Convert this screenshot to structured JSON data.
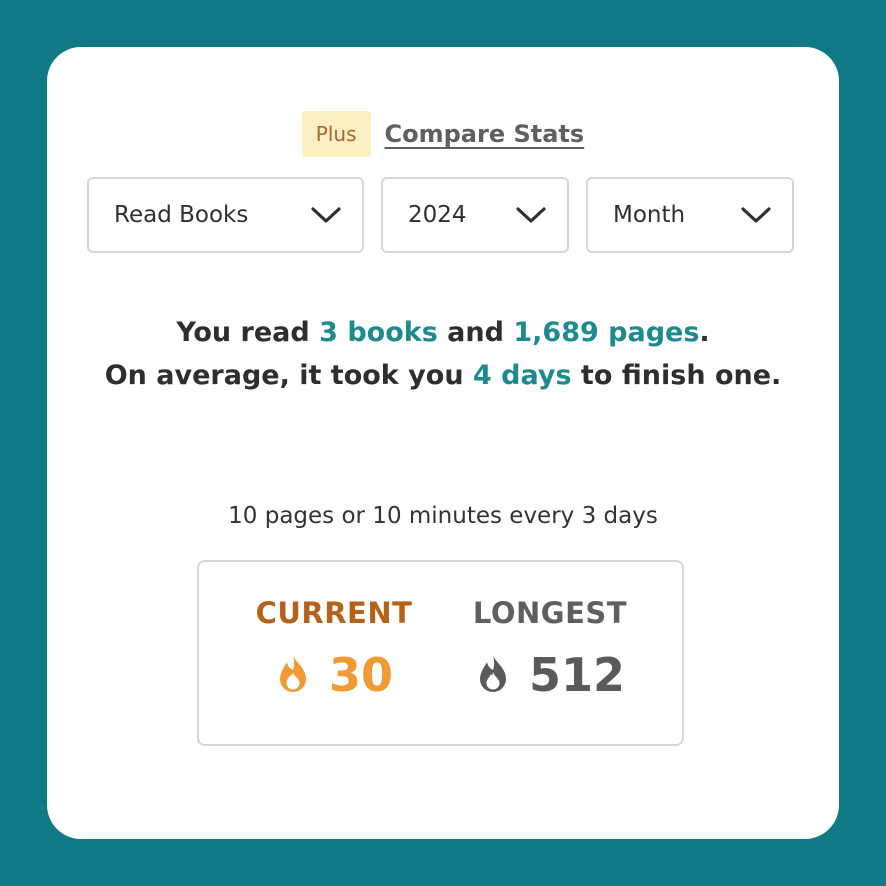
{
  "compare": {
    "plus_badge": "Plus",
    "link_label": "Compare Stats"
  },
  "filters": {
    "metric": "Read Books",
    "year": "2024",
    "period": "Month"
  },
  "summary": {
    "prefix": "You read ",
    "books": "3 books",
    "and": " and ",
    "pages": "1,689 pages",
    "after_pages": ".",
    "avg_prefix": "On average, it took you ",
    "days": "4 days",
    "avg_suffix": " to finish one."
  },
  "goal": "10 pages or 10 minutes every 3 days",
  "streaks": {
    "current": {
      "label": "CURRENT",
      "value": "30",
      "color": "#f29a32"
    },
    "longest": {
      "label": "LONGEST",
      "value": "512",
      "color": "#5a5a5a"
    }
  },
  "icons": {
    "dropdown": "chevron-down-icon",
    "streak": "flame-icon"
  }
}
